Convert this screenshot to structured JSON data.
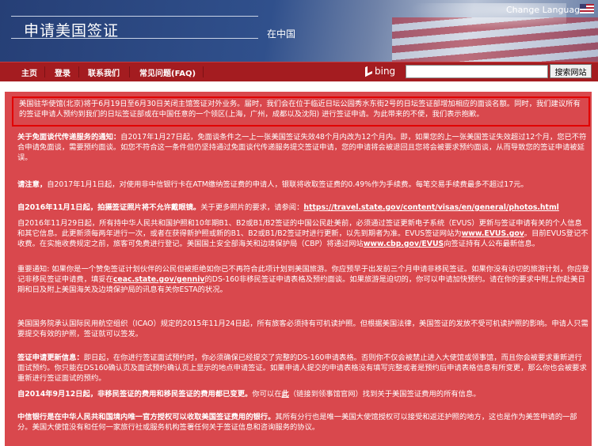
{
  "header": {
    "title": "申请美国签证",
    "subtitle": "在中国",
    "change_language": "Change Language:"
  },
  "nav": {
    "items": [
      "主页",
      "登录",
      "联系我们",
      "常见问题(FAQ)"
    ],
    "bing_label": "bing",
    "search_value": "",
    "search_button": "搜索网站"
  },
  "notices": {
    "alert": "美国驻华使馆(北京)将于6月19日至6月30日关闭主馆签证对外业务。届时，我们会在位于临近日坛公园秀水东街2号的日坛签证部增加相应的面谈名额。同时，我们建议所有的签证申请人预约到我们的日坛签证部或在中国任意的一个领区(上海，广州，成都以及沈阳) 进行签证申请。为此带来的不便，我们表示抱歉。",
    "waiver_bold": "关于免面谈代传递服务的通知：",
    "waiver_text": "自2017年1月27日起，免面谈条件之一上一张美国签证失效48个月内改为12个月内。即，如果您的上一张美国签证失效超过12个月，您已不符合申请免面谈，需要预约面谈。如您不符合这一条件但仍坚持通过免面谈代传递服务提交签证申请，您的申请将会被退回且您将会被要求预约面谈，从而导致您的签证申请被延误。",
    "fee_bold": "请注意，",
    "fee_text": "自2017年1月1日起，对使用非中信银行卡在ATM缴纳签证费的申请人，银联将收取签证费的0.49%作为手续费。每笔交易手续费最多不超过17元。",
    "photo_bold": "自2016年11月1日起，拍摄签证照片将不允许戴眼镜。",
    "photo_text": "关于更多照片的要求，请参阅：",
    "photo_link": "https://travel.state.gov/content/visas/en/general/photos.html",
    "evus_text_1": "自2016年11月29日起，所有持中华人民共和国护照和10年期B1、B2或B1/B2签证的中国公民赴美前，必须通过签证更新电子系统（EVUS）更新与签证申请有关的个人信息和其它信息。此更新须每两年进行一次，或者在获得新护照或新的B1、B2或B1/B2签证时进行更新，以先到期者为准。EVUS签证网站为",
    "evus_link_1": "www.EVUS.gov",
    "evus_text_2": "。目前EVUS登记不收费。在实施收费规定之前，旅客可免费进行登记。美国国土安全部海关和边境保护局（CBP）将通过网站",
    "evus_link_2": "www.cbp.gov/EVUS",
    "evus_text_3": "向签证持有人公布最新信息。",
    "esta_text_1": "重要通知: 如果你是一个赞免签证计划伙伴的公民但被拒绝如你已不再符合此项计划到美国旅游。你应预早于出发前三个月申请非移民签证。如果你没有访切的旅游计划，你应登记非移民签证申请费，填妥在",
    "esta_link": "ceac.state.gov/genniv",
    "esta_text_2": "的DS-160非移民签证申请表格及预约面谈。如果旅游是迫切的，你可以申请加快预约。请在你的要求中附上你赴美日期和日及附上美国海关及边境保护局的讯息有关你ESTA的状况。",
    "icao_text": "美国国务院承认国际民用航空组织（ICAO）规定的2015年11月24日起，所有旅客必须持有可机读护照。但根据美国法律，美国签证的发放不受可机读护照的影响。申请人只需要提交有效的护照，签证就可以签发。",
    "update_bold": "签证申请更新信息：",
    "update_text": "即日起，在你进行签证面试预约时，你必须确保已经提交了完整的DS-160申请表格。否则你不仅会被禁止进入大使馆或领事馆，而且你会被要求重新进行面试预约。你只能在DS160确认页及面试预约确认页上显示的地点申请签证。如果申请人提交的申请表格没有填写完整或者是预约后申请表格信息有所变更，那么你也会被要求重新进行签证面试的预约。",
    "fees_bold": "自2014年9月12日起，非移民签证的费用和移民签证的费用都已变更。",
    "fees_text_1": "你可以在",
    "fees_link": "此",
    "fees_text_2": "（链接到领事馆官网）找到关于美国签证费用的所有信息。",
    "citic_bold": "中信银行是在中华人民共和国境内唯一官方授权可以收取美国签证费用的银行。",
    "citic_text": "其所有分行也是唯一美国大使馆授权可以接受和返还护照的地方，这也是作为美签申请的一部分。美国大使馆没有和任何一家旅行社或服务机构签署任何关于签证信息和咨询服务的协议。"
  },
  "colors": {
    "nav_bg": "#a41c20",
    "content_bg": "#d9484d",
    "alert_border": "#e10000",
    "text": "#ffffff"
  }
}
